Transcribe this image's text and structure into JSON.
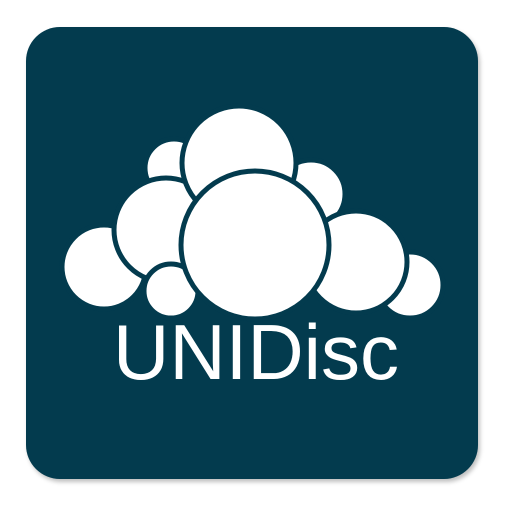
{
  "app": {
    "name": "UNIDisc"
  },
  "colors": {
    "background": "#033b4e",
    "foreground": "#ffffff"
  },
  "icons": {
    "logo": "cloud-icon"
  }
}
